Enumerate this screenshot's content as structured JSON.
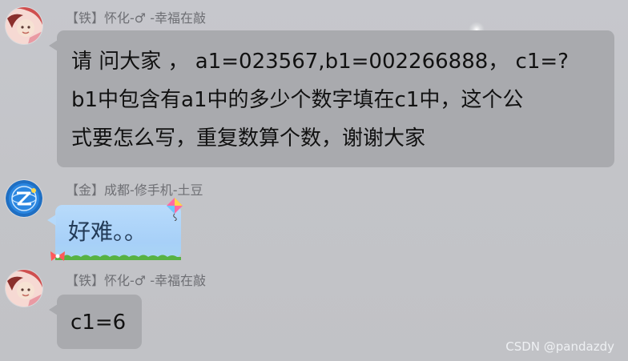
{
  "messages": [
    {
      "sender": "【铁】怀化-♂ -幸福在敲",
      "lines": [
        "请 问大家 ， a1=023567,b1=002266888，  c1=?",
        "b1中包含有a1中的多少个数字填在c1中，这个公",
        "式要怎么写，重复数算个数，谢谢大家"
      ]
    },
    {
      "sender": "【金】成都-修手机-土豆",
      "text": "好难。。"
    },
    {
      "sender": "【铁】怀化-♂ -幸福在敲",
      "text": "c1=6"
    }
  ],
  "watermark": "CSDN @pandazdy",
  "colors": {
    "background": "#c3c4c8",
    "bubble_gray": "#a9aaae",
    "bubble_blue": "#b5d9fa",
    "sender_text": "#6e6f74",
    "message_text": "#111111"
  }
}
